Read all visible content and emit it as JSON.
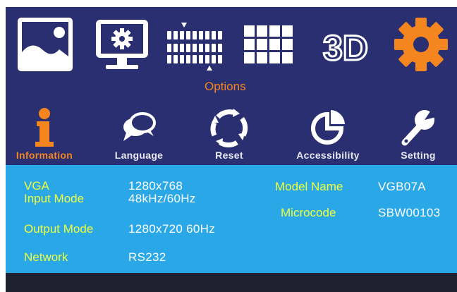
{
  "top_menu": {
    "items": [
      {
        "icon": "picture-icon"
      },
      {
        "icon": "display-settings-icon"
      },
      {
        "icon": "options-icon",
        "label": "Options"
      },
      {
        "icon": "grid-icon"
      },
      {
        "icon": "3d-icon",
        "text": "3D"
      },
      {
        "icon": "gear-icon"
      }
    ],
    "accent_color": "#f5861f"
  },
  "sub_menu": {
    "items": [
      {
        "icon": "information-icon",
        "label": "Information"
      },
      {
        "icon": "language-icon",
        "label": "Language"
      },
      {
        "icon": "reset-icon",
        "label": "Reset"
      },
      {
        "icon": "accessibility-icon",
        "label": "Accessibility"
      },
      {
        "icon": "setting-icon",
        "label": "Setting"
      }
    ]
  },
  "info": {
    "source_label": "VGA",
    "source_value": "1280x768",
    "input_mode_label": "Input Mode",
    "input_mode_value": "48kHz/60Hz",
    "output_mode_label": "Output Mode",
    "output_mode_value": "1280x720 60Hz",
    "network_label": "Network",
    "network_value": "RS232",
    "model_name_label": "Model Name",
    "model_name_value": "VGB07A",
    "microcode_label": "Microcode",
    "microcode_value": "SBW00103"
  },
  "colors": {
    "background": "#2a2f72",
    "panel": "#29a7e6",
    "label": "#f0ff3c",
    "value": "#ffffff",
    "active": "#f5861f"
  }
}
